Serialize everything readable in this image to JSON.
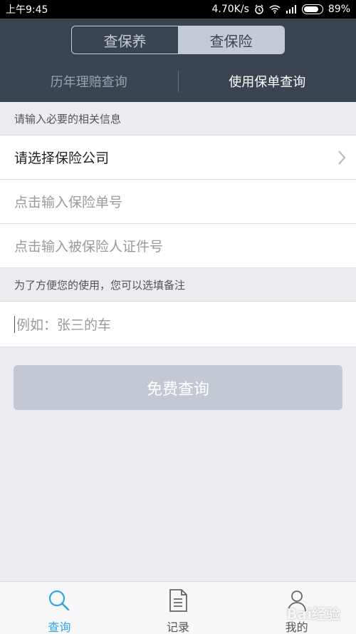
{
  "status_bar": {
    "time": "上午9:45",
    "speed": "4.70K/s",
    "battery": "89%",
    "battery_level": 0.89
  },
  "segment": {
    "tabs": [
      "查保养",
      "查保险"
    ],
    "active_index": 1
  },
  "subtabs": {
    "items": [
      "历年理赔查询",
      "使用保单查询"
    ],
    "active_index": 1
  },
  "form": {
    "section1_label": "请输入必要的相关信息",
    "company_select": "请选择保险公司",
    "policy_placeholder": "点击输入保险单号",
    "id_placeholder": "点击输入被保险人证件号",
    "section2_label": "为了方便您的使用，您可以选填备注",
    "remark_placeholder": "例如：张三的车"
  },
  "submit_button": "免费查询",
  "tab_bar": {
    "items": [
      {
        "label": "查询",
        "icon": "search-icon"
      },
      {
        "label": "记录",
        "icon": "document-icon"
      },
      {
        "label": "我的",
        "icon": "user-icon"
      }
    ],
    "active_index": 0
  },
  "watermark": "Bai经验",
  "colors": {
    "header_bg": "#3b4451",
    "accent": "#2fa6e0",
    "button_disabled": "#c3c9d2"
  }
}
